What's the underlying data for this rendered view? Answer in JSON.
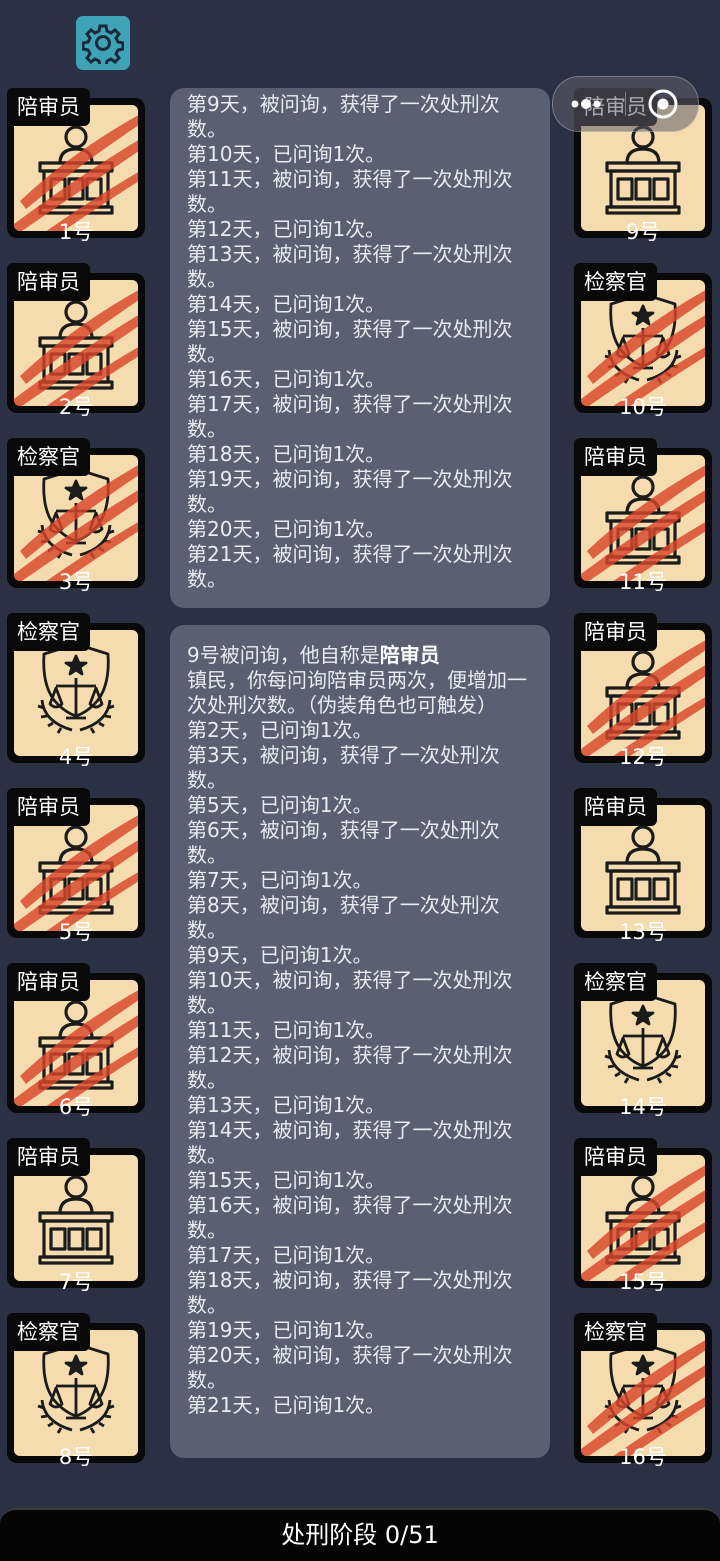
{
  "bottom_bar": {
    "label": "处刑阶段 0/51"
  },
  "cards_left": [
    {
      "role": "陪审员",
      "number": "1号",
      "icon": "juror-icon",
      "slashed": true
    },
    {
      "role": "陪审员",
      "number": "2号",
      "icon": "juror-icon",
      "slashed": true
    },
    {
      "role": "检察官",
      "number": "3号",
      "icon": "prosecutor-icon",
      "slashed": true
    },
    {
      "role": "检察官",
      "number": "4号",
      "icon": "prosecutor-icon",
      "slashed": false
    },
    {
      "role": "陪审员",
      "number": "5号",
      "icon": "juror-icon",
      "slashed": true
    },
    {
      "role": "陪审员",
      "number": "6号",
      "icon": "juror-icon",
      "slashed": true
    },
    {
      "role": "陪审员",
      "number": "7号",
      "icon": "juror-icon",
      "slashed": false
    },
    {
      "role": "检察官",
      "number": "8号",
      "icon": "prosecutor-icon",
      "slashed": false
    }
  ],
  "cards_right": [
    {
      "role": "陪审员",
      "number": "9号",
      "icon": "juror-icon",
      "slashed": false
    },
    {
      "role": "检察官",
      "number": "10号",
      "icon": "prosecutor-icon",
      "slashed": true
    },
    {
      "role": "陪审员",
      "number": "11号",
      "icon": "juror-icon",
      "slashed": true
    },
    {
      "role": "陪审员",
      "number": "12号",
      "icon": "juror-icon",
      "slashed": true
    },
    {
      "role": "陪审员",
      "number": "13号",
      "icon": "juror-icon",
      "slashed": false
    },
    {
      "role": "检察官",
      "number": "14号",
      "icon": "prosecutor-icon",
      "slashed": false
    },
    {
      "role": "陪审员",
      "number": "15号",
      "icon": "juror-icon",
      "slashed": true
    },
    {
      "role": "检察官",
      "number": "16号",
      "icon": "prosecutor-icon",
      "slashed": true
    }
  ],
  "log_top": {
    "lines": [
      "第9天，被问询，获得了一次处刑次数。",
      "第10天，已问询1次。",
      "第11天，被问询，获得了一次处刑次数。",
      "第12天，已问询1次。",
      "第13天，被问询，获得了一次处刑次数。",
      "第14天，已问询1次。",
      "第15天，被问询，获得了一次处刑次数。",
      "第16天，已问询1次。",
      "第17天，被问询，获得了一次处刑次数。",
      "第18天，已问询1次。",
      "第19天，被问询，获得了一次处刑次数。",
      "第20天，已问询1次。",
      "第21天，被问询，获得了一次处刑次数。"
    ]
  },
  "log_bottom": {
    "intro_prefix": "9号被问询，他自称是",
    "intro_role": "陪审员",
    "rule": "镇民，你每问询陪审员两次，便增加一次处刑次数。（伪装角色也可触发）",
    "lines": [
      "第2天，已问询1次。",
      "第3天，被问询，获得了一次处刑次数。",
      "第5天，已问询1次。",
      "第6天，被问询，获得了一次处刑次数。",
      "第7天，已问询1次。",
      "第8天，被问询，获得了一次处刑次数。",
      "第9天，已问询1次。",
      "第10天，被问询，获得了一次处刑次数。",
      "第11天，已问询1次。",
      "第12天，被问询，获得了一次处刑次数。",
      "第13天，已问询1次。",
      "第14天，被问询，获得了一次处刑次数。",
      "第15天，已问询1次。",
      "第16天，被问询，获得了一次处刑次数。",
      "第17天，已问询1次。",
      "第18天，被问询，获得了一次处刑次数。",
      "第19天，已问询1次。",
      "第20天，被问询，获得了一次处刑次数。",
      "第21天，已问询1次。"
    ]
  }
}
